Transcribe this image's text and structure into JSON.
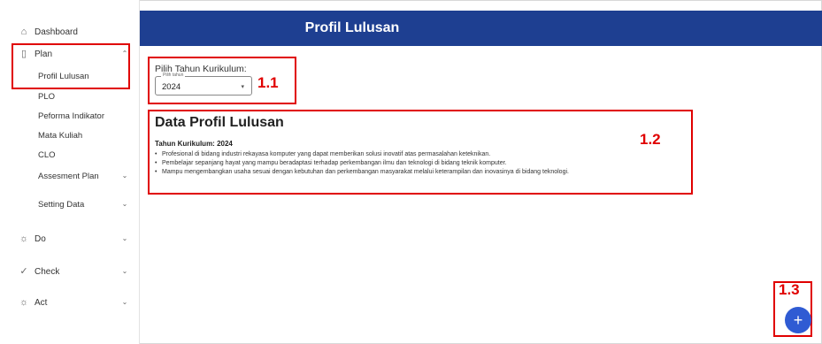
{
  "sidebar": {
    "items": [
      {
        "label": "Dashboard",
        "icon": "home-icon"
      },
      {
        "label": "Plan",
        "icon": "clipboard-icon",
        "expanded": true
      },
      {
        "label": "Profil Lulusan"
      },
      {
        "label": "PLO"
      },
      {
        "label": "Peforma Indikator"
      },
      {
        "label": "Mata Kuliah"
      },
      {
        "label": "CLO"
      },
      {
        "label": "Assesment Plan"
      },
      {
        "label": "Setting Data"
      },
      {
        "label": "Do",
        "icon": "lightbulb-icon"
      },
      {
        "label": "Check",
        "icon": "check-icon"
      },
      {
        "label": "Act",
        "icon": "lightbulb-icon"
      }
    ]
  },
  "header": {
    "title": "Profil Lulusan"
  },
  "curriculum": {
    "label": "Pilih Tahun Kurikulum:",
    "select_legend": "Pilih tahun",
    "selected": "2024"
  },
  "data_card": {
    "title": "Data Profil Lulusan",
    "subtitle": "Tahun Kurikulum: 2024",
    "items": [
      "Profesional di bidang industri rekayasa komputer yang dapat memberikan solusi inovatif atas permasalahan keteknikan.",
      "Pembelajar sepanjang hayat yang mampu beradaptasi terhadap perkembangan ilmu dan teknologi di bidang teknik komputer.",
      "Mampu mengembangkan usaha sesuai dengan kebutuhan dan perkembangan masyarakat melalui keterampilan dan inovasinya di bidang teknologi."
    ]
  },
  "annotations": {
    "a1": "1.1",
    "a2": "1.2",
    "a3": "1.3"
  },
  "fab": {
    "label": "+"
  },
  "colors": {
    "header": "#1e3f91",
    "annotation": "#e00000",
    "fab": "#2f5bd3"
  }
}
